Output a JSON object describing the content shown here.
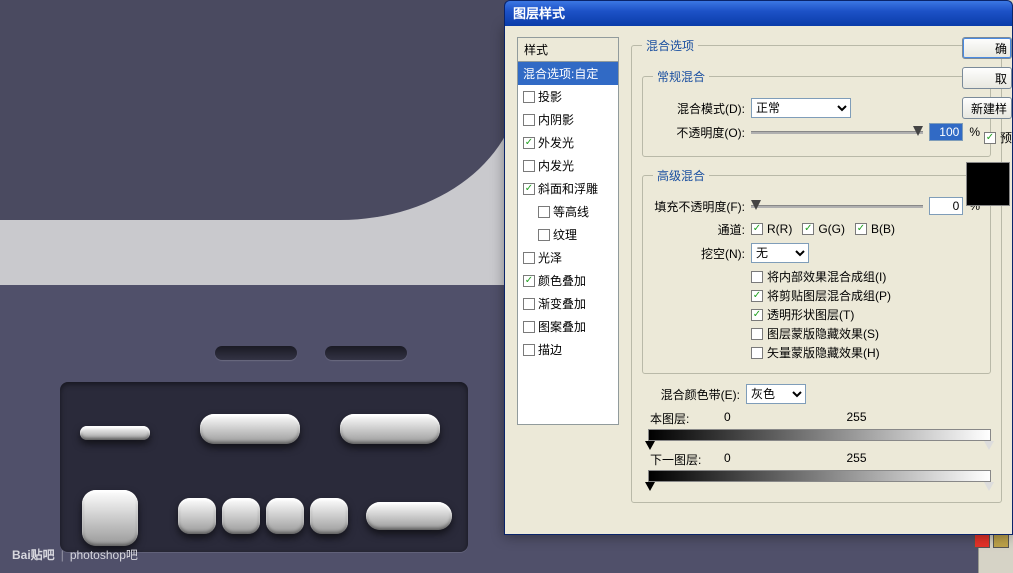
{
  "watermark": {
    "logo": "Bai贴吧",
    "divider": "|",
    "text": "photoshop吧"
  },
  "dialog": {
    "title": "图层样式",
    "styles_header": "样式",
    "styles": [
      {
        "label": "混合选项:自定",
        "checked": null,
        "selected": true
      },
      {
        "label": "投影",
        "checked": false
      },
      {
        "label": "内阴影",
        "checked": false
      },
      {
        "label": "外发光",
        "checked": true
      },
      {
        "label": "内发光",
        "checked": false
      },
      {
        "label": "斜面和浮雕",
        "checked": true
      },
      {
        "label": "等高线",
        "checked": false,
        "indent": true
      },
      {
        "label": "纹理",
        "checked": false,
        "indent": true
      },
      {
        "label": "光泽",
        "checked": false
      },
      {
        "label": "颜色叠加",
        "checked": true
      },
      {
        "label": "渐变叠加",
        "checked": false
      },
      {
        "label": "图案叠加",
        "checked": false
      },
      {
        "label": "描边",
        "checked": false
      }
    ],
    "buttons": {
      "ok": "确",
      "cancel": "取",
      "new": "新建样",
      "preview": "预"
    },
    "blending": {
      "group_label": "混合选项",
      "general": {
        "legend": "常规混合",
        "mode_label": "混合模式(D):",
        "mode_value": "正常",
        "opacity_label": "不透明度(O):",
        "opacity_value": "100",
        "pct": "%"
      },
      "advanced": {
        "legend": "高级混合",
        "fill_label": "填充不透明度(F):",
        "fill_value": "0",
        "pct": "%",
        "channels_label": "通道:",
        "ch_r": "R(R)",
        "ch_g": "G(G)",
        "ch_b": "B(B)",
        "knockout_label": "挖空(N):",
        "knockout_value": "无",
        "opts": [
          {
            "label": "将内部效果混合成组(I)",
            "checked": false
          },
          {
            "label": "将剪贴图层混合成组(P)",
            "checked": true
          },
          {
            "label": "透明形状图层(T)",
            "checked": true
          },
          {
            "label": "图层蒙版隐藏效果(S)",
            "checked": false
          },
          {
            "label": "矢量蒙版隐藏效果(H)",
            "checked": false
          }
        ]
      },
      "blendif": {
        "label": "混合颜色带(E):",
        "value": "灰色",
        "this_label": "本图层:",
        "this_low": "0",
        "this_high": "255",
        "under_label": "下一图层:",
        "under_low": "0",
        "under_high": "255"
      }
    }
  }
}
